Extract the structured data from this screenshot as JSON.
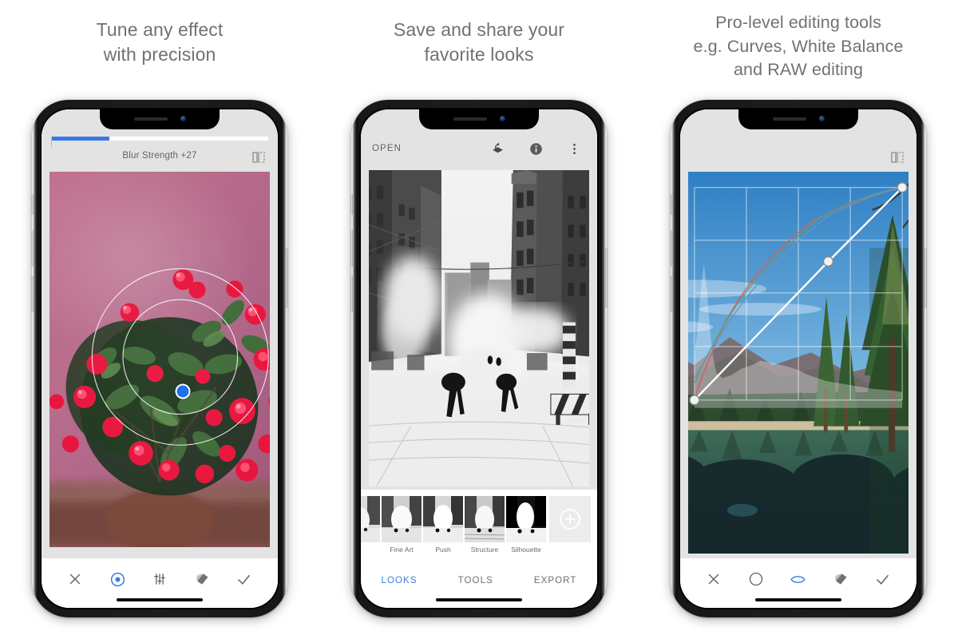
{
  "panels": [
    {
      "caption": "Tune any effect\nwith precision",
      "app": {
        "parameter_label": "Blur Strength +27",
        "progress_percent": 27,
        "accent_color": "#3b78e7",
        "compare_icon": "compare-split-icon",
        "photo_description": "Pink wall with red crown-of-thorns flowers",
        "lens_blur": {
          "inner_radius_label": "inner-blur-ring",
          "outer_radius_label": "outer-blur-ring",
          "handle_color": "#1a73e8"
        },
        "bottom_bar": [
          {
            "name": "cancel-button",
            "icon": "close-icon",
            "active": false
          },
          {
            "name": "lens-blur-button",
            "icon": "target-dot-icon",
            "active": true
          },
          {
            "name": "adjust-sliders-button",
            "icon": "sliders-icon",
            "active": false
          },
          {
            "name": "looks-stack-button",
            "icon": "layers-stack-icon",
            "active": false
          },
          {
            "name": "apply-button",
            "icon": "check-icon",
            "active": false
          }
        ]
      }
    },
    {
      "caption": "Save and share your\nfavorite looks",
      "app": {
        "open_label": "OPEN",
        "top_icons": [
          {
            "name": "undo-stack-button",
            "icon": "undo-stack-icon"
          },
          {
            "name": "info-button",
            "icon": "info-icon"
          },
          {
            "name": "overflow-menu-button",
            "icon": "more-vertical-icon"
          }
        ],
        "photo_description": "Black and white snowy city street with steam",
        "looks": [
          {
            "label": "Fine Art",
            "style": "fineart"
          },
          {
            "label": "Push",
            "style": "push"
          },
          {
            "label": "Structure",
            "style": "structure"
          },
          {
            "label": "Silhouette",
            "style": "silhouette"
          }
        ],
        "add_look": {
          "name": "add-look-button",
          "icon": "plus-circle-icon"
        },
        "tabs": [
          {
            "label": "LOOKS",
            "active": true
          },
          {
            "label": "TOOLS",
            "active": false
          },
          {
            "label": "EXPORT",
            "active": false
          }
        ],
        "accent_color": "#3b7ddd"
      }
    },
    {
      "caption": "Pro-level editing tools\ne.g. Curves, White Balance\nand RAW editing",
      "app": {
        "compare_icon": "compare-split-icon",
        "photo_description": "Mountain lake with pine trees and blue sky",
        "curves": {
          "grid_divisions": 4,
          "master_points": [
            [
              0,
              0
            ],
            [
              0.64,
              0.64
            ],
            [
              1,
              1
            ]
          ],
          "channels": [
            {
              "name": "red",
              "color": "#d0625f"
            },
            {
              "name": "green",
              "color": "#5f9e7a"
            },
            {
              "name": "blue",
              "color": "#6b93c4"
            }
          ],
          "histogram": true
        },
        "bottom_bar": [
          {
            "name": "cancel-button",
            "icon": "close-icon",
            "active": false
          },
          {
            "name": "tone-curve-button",
            "icon": "contrast-circle-icon",
            "active": false
          },
          {
            "name": "preview-eye-button",
            "icon": "eye-icon",
            "active": true
          },
          {
            "name": "looks-stack-button",
            "icon": "layers-stack-icon",
            "active": false
          },
          {
            "name": "apply-button",
            "icon": "check-icon",
            "active": false
          }
        ],
        "accent_color": "#3b7ddd"
      }
    }
  ]
}
